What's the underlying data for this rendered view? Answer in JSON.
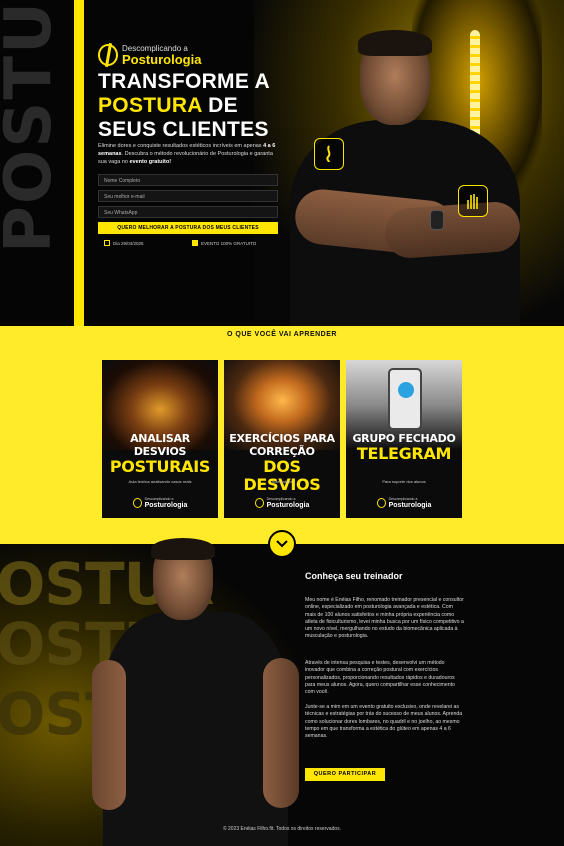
{
  "colors": {
    "accent": "#ffe600",
    "background": "#050505",
    "learn_bg": "#ffeb2a"
  },
  "hero": {
    "bg_word": "POSTU",
    "logo_small": "Descomplicando a",
    "logo_big": "Posturologia",
    "headline_1": "TRANSFORME A",
    "headline_2_highlight": "POSTURA",
    "headline_2_rest": " DE",
    "headline_3": "SEUS CLIENTES",
    "subtitle_1": "Elimine dores e conquiste resultados estéticos incríveis em apenas ",
    "subtitle_bold_1": "4 a 6 semanas",
    "subtitle_2": ". Descubra o método revolucionário de Posturologia e garanta sua vaga no ",
    "subtitle_bold_2": "evento gratuito!",
    "fields": {
      "name": "Nome Completo",
      "email": "Seu melhor e-mail",
      "whatsapp": "Seu WhatsApp"
    },
    "cta": "QUERO MELHORAR A POSTURA DOS MEUS CLIENTES",
    "meta_date": "Dia 29/04/2025",
    "meta_free": "EVENTO 100% GRATUITO",
    "icons": {
      "badge_1": "spine-icon",
      "badge_2": "hand-icon"
    }
  },
  "learn": {
    "title": "O QUE VOCÊ VAI APRENDER",
    "cards": [
      {
        "line1": "ANALISAR DESVIOS",
        "line2": "POSTURAIS",
        "desc": "Aula teórica analisando casos reais",
        "logo_small": "Descomplicando a",
        "logo_big": "Posturologia"
      },
      {
        "line1": "EXERCÍCIOS PARA CORREÇÃO",
        "line2": "DOS DESVIOS",
        "desc": "Aula prática",
        "logo_small": "Descomplicando a",
        "logo_big": "Posturologia"
      },
      {
        "line1": "GRUPO FECHADO",
        "line2": "TELEGRAM",
        "desc": "Para suporte dos alunos",
        "logo_small": "Descomplicando a",
        "logo_big": "Posturologia"
      }
    ]
  },
  "trainer": {
    "bg_words": [
      "OSTUR",
      "OSTU",
      "OSTU"
    ],
    "title": "Conheça seu treinador",
    "p1": "Meu nome é Enéias Filho, renomado treinador presencial e consultor online, especializado em posturologia avançada e estética. Com mais de 100 alunos satisfeitos e minha própria experiência como atleta de fisiculturismo, levei minha busca por um físico competitivo a um novo nível, mergulhando no estudo da biomecânica aplicada à musculação e posturologia.",
    "p2": "Através de intensa pesquisa e testes, desenvolvi um método inovador que combina a correção postural com exercícios personalizados, proporcionando resultados rápidos e duradouros para meus alunos. Agora, quero compartilhar esse conhecimento com você.",
    "p3": "Junte-se a mim em um evento gratuito exclusivo, onde revelarei as técnicas e estratégias por trás do sucesso de meus alunos. Aprenda como solucionar dores lombares, no quadril e no joelho, ao mesmo tempo em que transforma a estética do glúteo em apenas 4 a 6 semanas.",
    "cta": "QUERO PARTICIPAR",
    "scroll_icon": "chevron-down-icon"
  },
  "footer": "© 2023 Enéias Filho.fit. Todos os direitos reservados."
}
